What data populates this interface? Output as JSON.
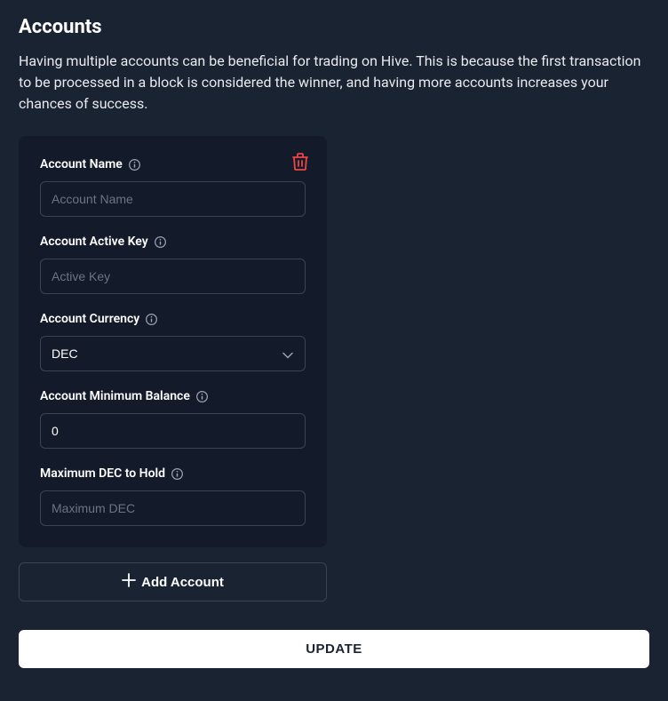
{
  "page": {
    "title": "Accounts",
    "description": "Having multiple accounts can be beneficial for trading on Hive. This is because the first transaction to be processed in a block is considered the winner, and having more accounts increases your chances of success."
  },
  "fields": {
    "accountName": {
      "label": "Account Name",
      "placeholder": "Account Name",
      "value": ""
    },
    "activeKey": {
      "label": "Account Active Key",
      "placeholder": "Active Key",
      "value": ""
    },
    "currency": {
      "label": "Account Currency",
      "selected": "DEC"
    },
    "minBalance": {
      "label": "Account Minimum Balance",
      "value": "0"
    },
    "maxDec": {
      "label": "Maximum DEC to Hold",
      "placeholder": "Maximum DEC",
      "value": ""
    }
  },
  "buttons": {
    "addAccount": "Add Account",
    "update": "UPDATE"
  }
}
